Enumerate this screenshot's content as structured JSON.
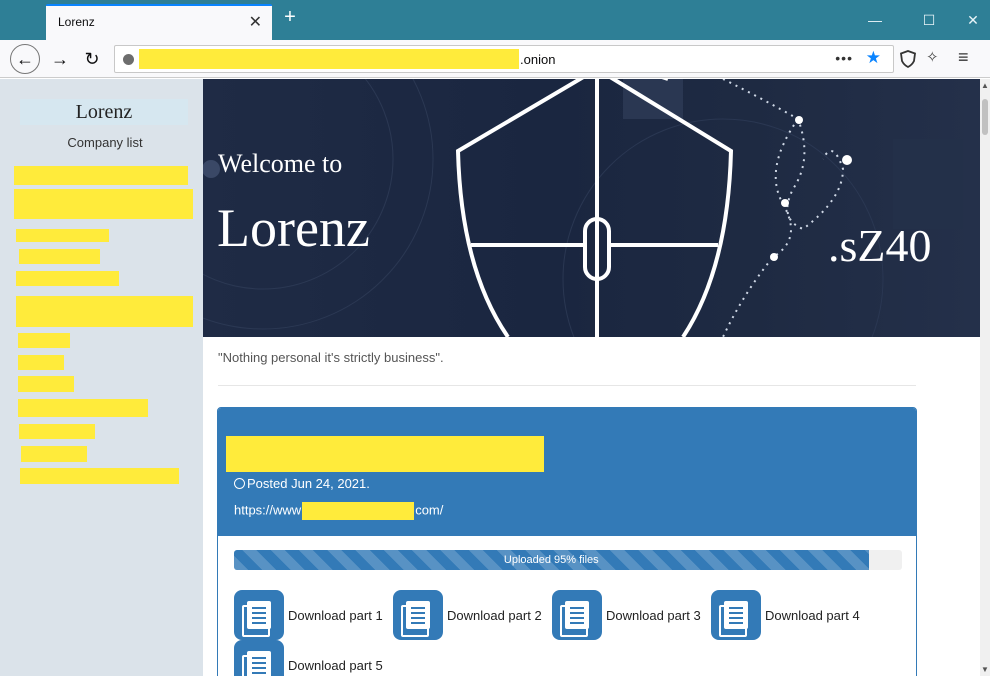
{
  "browser": {
    "tab_title": "Lorenz",
    "tab_close": "✕",
    "new_tab": "+",
    "url_suffix": ".onion",
    "url_dots": "•••",
    "win_min": "—",
    "win_max": "☐",
    "win_close": "✕"
  },
  "sidebar": {
    "title": "Lorenz",
    "subtitle": "Company list"
  },
  "hero": {
    "welcome": "Welcome to",
    "name": "Lorenz",
    "code": ".sZ40"
  },
  "tagline": "\"Nothing personal it's strictly business\".",
  "post": {
    "posted": "Posted Jun 24, 2021.",
    "url_prefix": "https://www",
    "url_suffix": "com/",
    "progress_label": "Uploaded 95% files",
    "progress_fraction": 0.95,
    "downloads": [
      "Download part 1",
      "Download part 2",
      "Download part 3",
      "Download part 4",
      "Download part 5"
    ]
  },
  "colors": {
    "titlebar": "#2e7f96",
    "accent": "#337ab7",
    "redaction": "#ffeb3b",
    "sidebar": "#dbe3ea"
  }
}
